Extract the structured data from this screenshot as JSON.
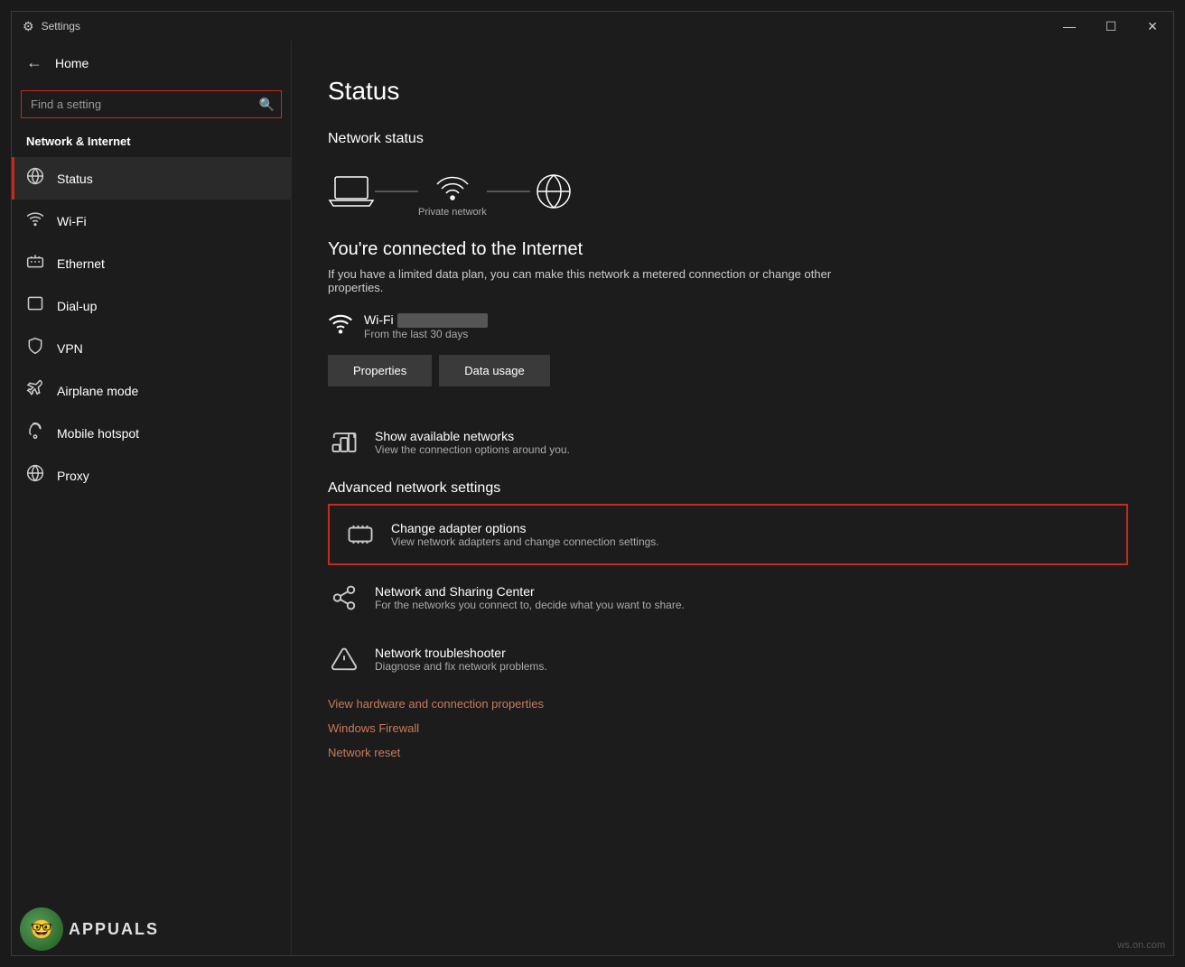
{
  "window": {
    "title": "Settings",
    "controls": {
      "minimize": "—",
      "maximize": "☐",
      "close": "✕"
    }
  },
  "sidebar": {
    "home_label": "Home",
    "search_placeholder": "Find a setting",
    "section_label": "Network & Internet",
    "items": [
      {
        "id": "status",
        "label": "Status",
        "icon": "🌐",
        "active": true
      },
      {
        "id": "wifi",
        "label": "Wi-Fi",
        "icon": "wifi"
      },
      {
        "id": "ethernet",
        "label": "Ethernet",
        "icon": "ethernet"
      },
      {
        "id": "dialup",
        "label": "Dial-up",
        "icon": "dialup"
      },
      {
        "id": "vpn",
        "label": "VPN",
        "icon": "vpn"
      },
      {
        "id": "airplane",
        "label": "Airplane mode",
        "icon": "airplane"
      },
      {
        "id": "hotspot",
        "label": "Mobile hotspot",
        "icon": "hotspot"
      },
      {
        "id": "proxy",
        "label": "Proxy",
        "icon": "proxy"
      }
    ]
  },
  "content": {
    "page_title": "Status",
    "network_status_label": "Network status",
    "network_label": "Private network",
    "connection_title": "You're connected to the Internet",
    "connection_desc": "If you have a limited data plan, you can make this network a metered connection or change other properties.",
    "wifi_days": "From the last 30 days",
    "btn_properties": "Properties",
    "btn_data_usage": "Data usage",
    "show_networks_title": "Show available networks",
    "show_networks_desc": "View the connection options around you.",
    "advanced_title": "Advanced network settings",
    "adapter_title": "Change adapter options",
    "adapter_desc": "View network adapters and change connection settings.",
    "sharing_title": "Network and Sharing Center",
    "sharing_desc": "For the networks you connect to, decide what you want to share.",
    "troubleshooter_title": "Network troubleshooter",
    "troubleshooter_desc": "Diagnose and fix network problems.",
    "link1": "View hardware and connection properties",
    "link2": "Windows Firewall",
    "link3": "Network reset"
  },
  "watermark": "ws.on.com",
  "brand": "APPUALS"
}
